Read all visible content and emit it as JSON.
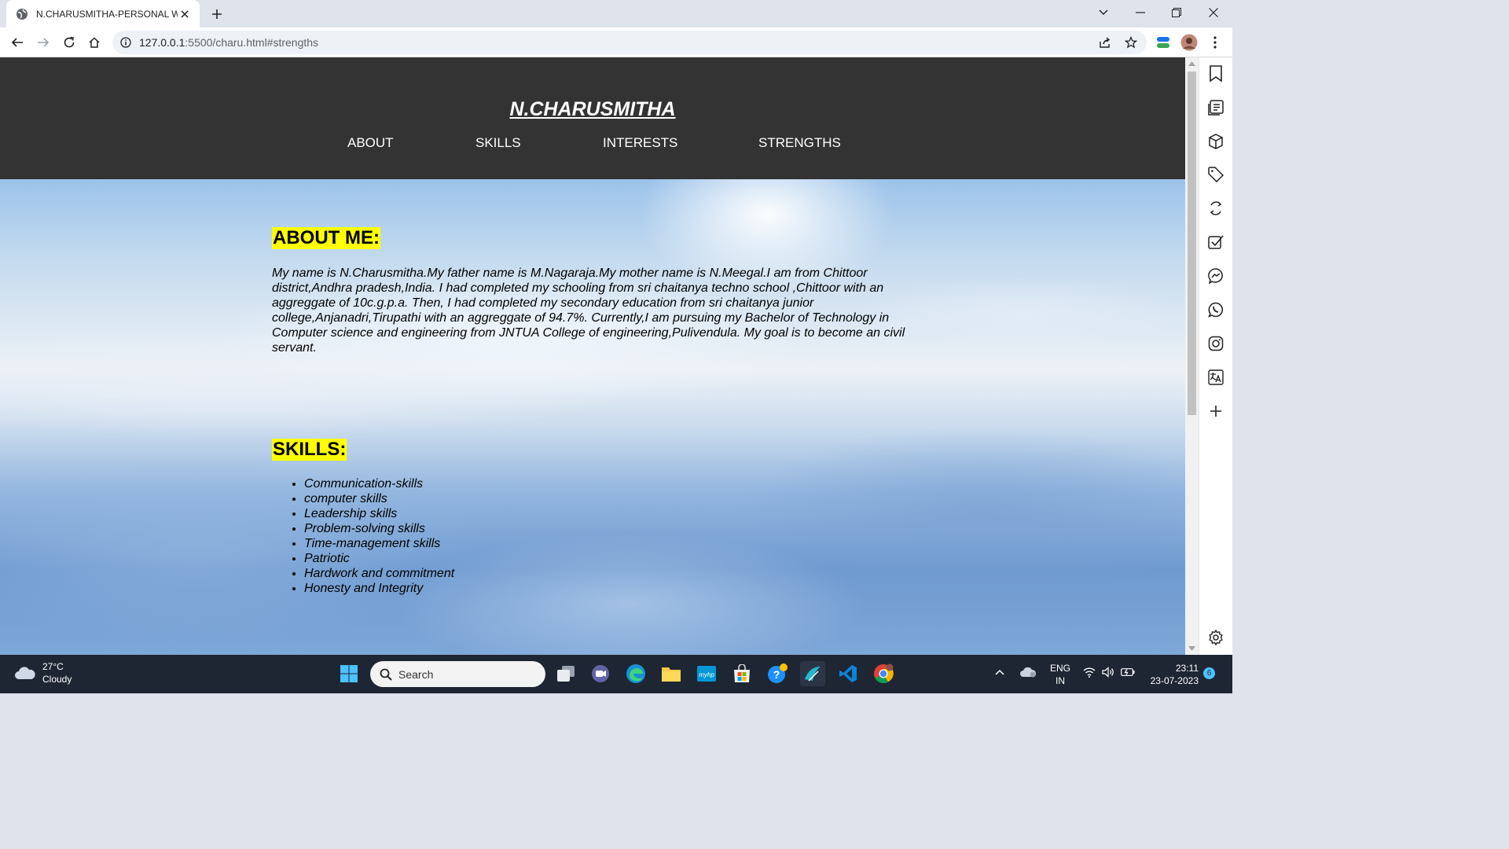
{
  "browser": {
    "tab_title": "N.CHARUSMITHA-PERSONAL WE",
    "url_host": "127.0.0.1",
    "url_rest": ":5500/charu.html#strengths"
  },
  "site": {
    "title": "N.CHARUSMITHA",
    "nav": [
      "ABOUT",
      "SKILLS",
      "INTERESTS",
      "STRENGTHS"
    ],
    "about_heading": "ABOUT ME:",
    "about_text": "My name is N.Charusmitha.My father name is M.Nagaraja.My mother name is N.Meegal.I am from Chittoor district,Andhra pradesh,India. I had completed my schooling from sri chaitanya techno school ,Chittoor with an aggreggate of 10c.g.p.a. Then, I had completed my secondary education from sri chaitanya junior college,Anjanadri,Tirupathi with an aggreggate of 94.7%. Currently,I am pursuing my Bachelor of Technology in Computer science and engineering from JNTUA College of engineering,Pulivendula. My goal is to become an civil servant.",
    "skills_heading": "SKILLS:",
    "skills": [
      "Communication-skills",
      "computer skills",
      "Leadership skills",
      "Problem-solving skills",
      "Time-management skills",
      "Patriotic",
      "Hardwork and commitment",
      "Honesty and Integrity"
    ]
  },
  "taskbar": {
    "temperature": "27°C",
    "weather": "Cloudy",
    "search_label": "Search",
    "lang_top": "ENG",
    "lang_bottom": "IN",
    "time": "23:11",
    "date": "23-07-2023",
    "notification_count": "6"
  },
  "colors": {
    "header_bg": "#333333",
    "heading_highlight": "#ffff00",
    "taskbar_bg": "#1e2633"
  }
}
